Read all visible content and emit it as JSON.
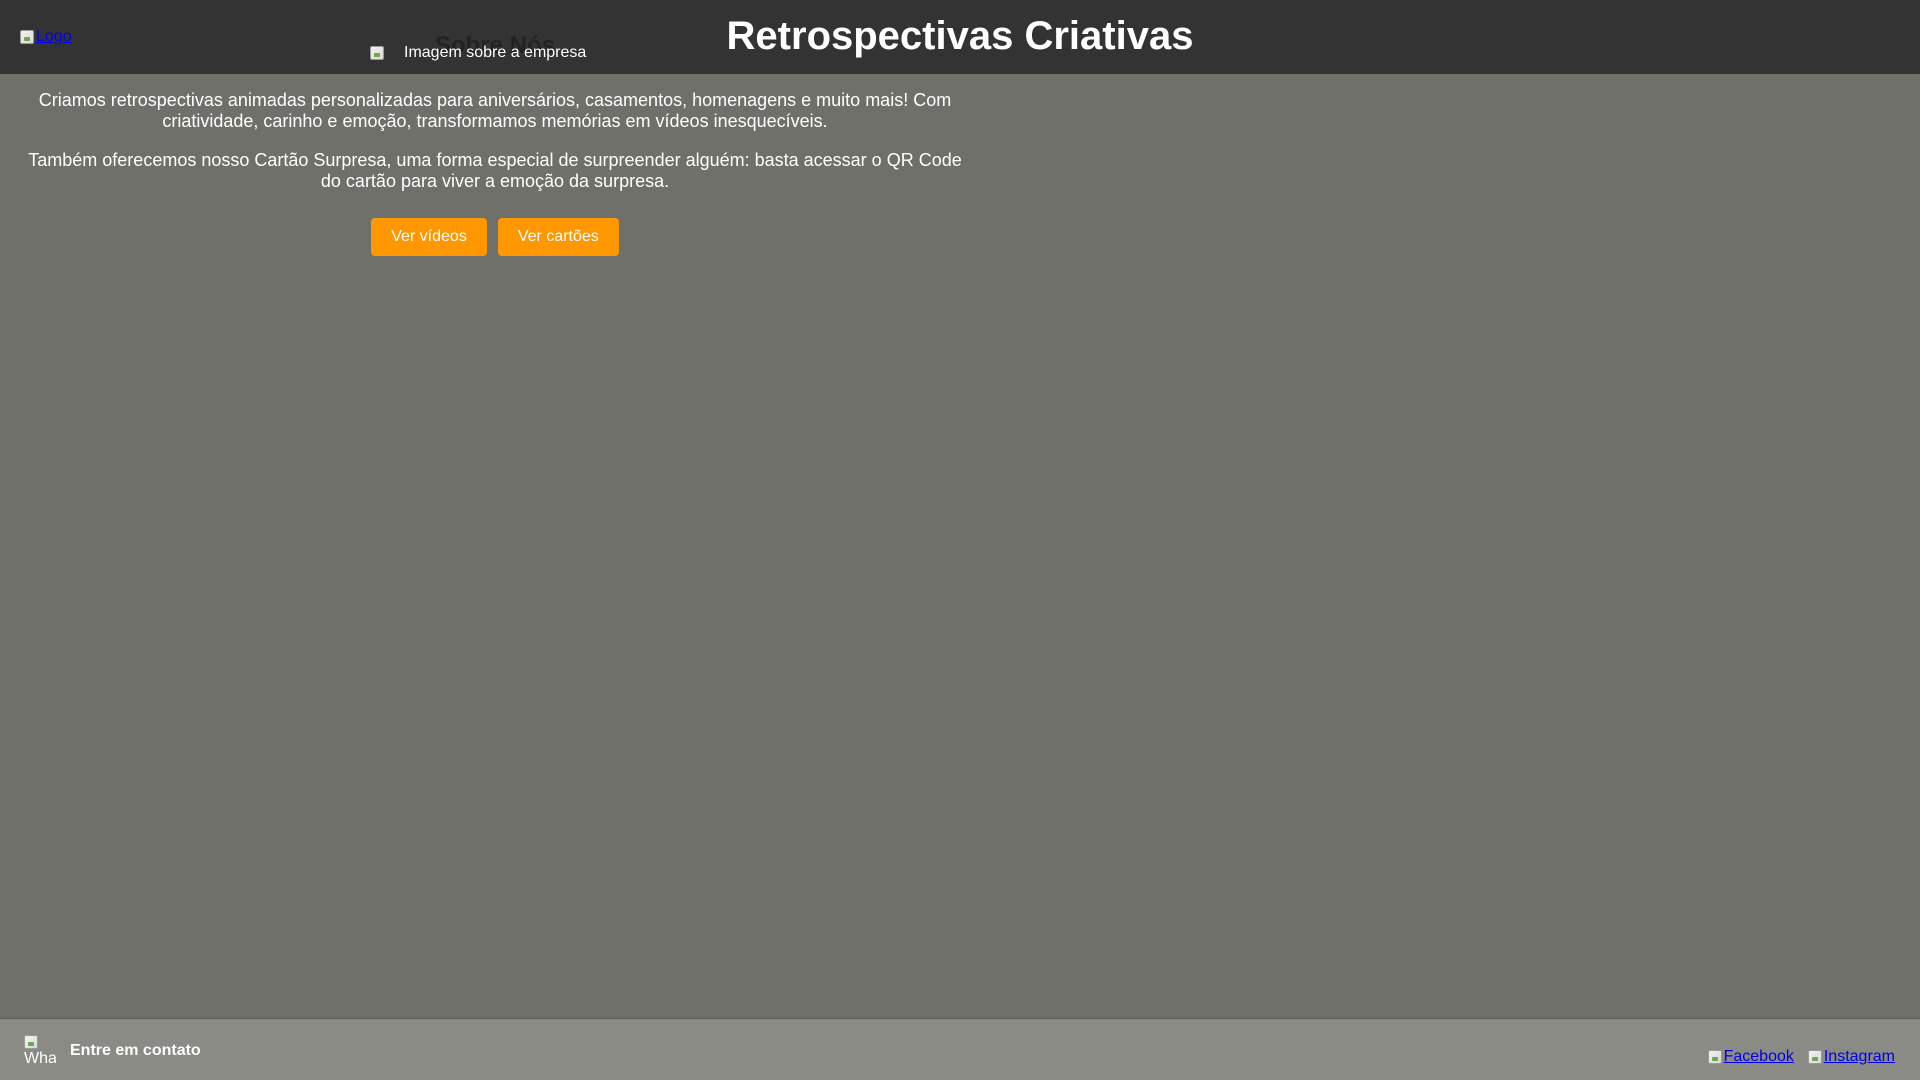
{
  "header": {
    "logo_alt": "Logo",
    "title": "Retrospectivas Criativas"
  },
  "about": {
    "title": "Sobre Nós",
    "image_alt": "Imagem sobre a empresa",
    "paragraph1": "Criamos retrospectivas animadas personalizadas para aniversários, casamentos, homenagens e muito mais! Com criatividade, carinho e emoção, transformamos memórias em vídeos inesquecíveis.",
    "paragraph2": "Também oferecemos nosso Cartão Surpresa, uma forma especial de surpreender alguém: basta acessar o QR Code do cartão para viver a emoção da surpresa.",
    "buttons": {
      "videos": "Ver vídeos",
      "cards": "Ver cartões"
    }
  },
  "footer": {
    "whatsapp_alt": "Wha",
    "contact_label": "Entre em contato",
    "facebook": "Facebook",
    "instagram": "Instagram"
  },
  "colors": {
    "header_bg": "#333333",
    "page_bg": "#6f706a",
    "button": "#ff9800",
    "footer_bg": "#8a8b85",
    "link": "#0000ee"
  }
}
